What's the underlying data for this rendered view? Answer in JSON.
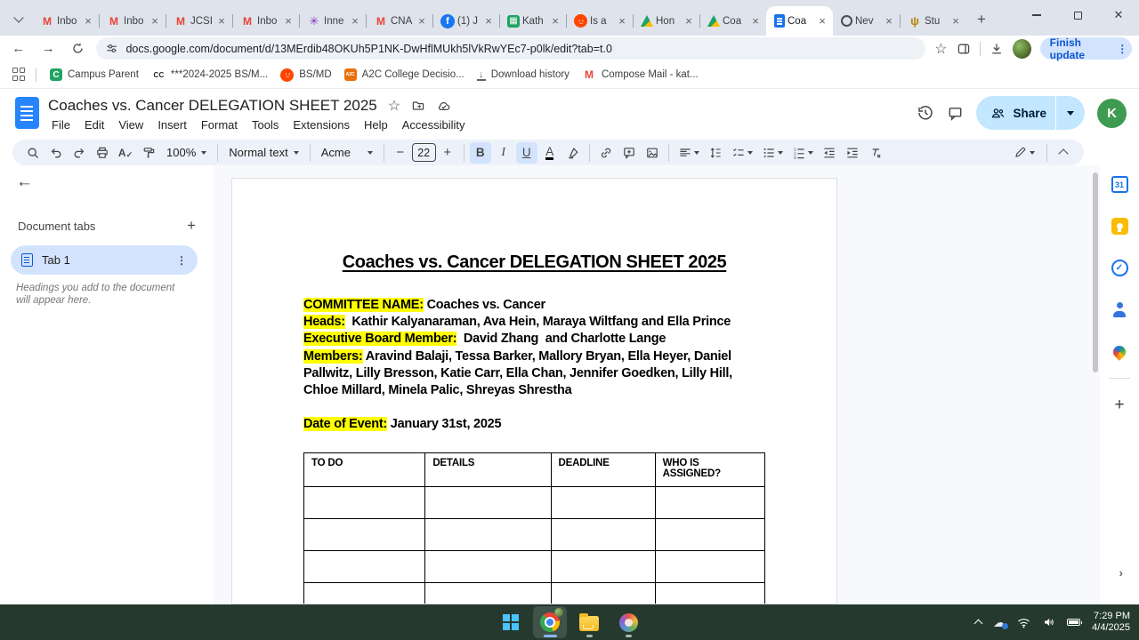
{
  "browser": {
    "tab_strip": {
      "tabs": [
        {
          "icon": "gmail",
          "label": "Inbo"
        },
        {
          "icon": "gmail",
          "label": "Inbo"
        },
        {
          "icon": "gmail",
          "label": "JCSI"
        },
        {
          "icon": "gmail",
          "label": "Inbo"
        },
        {
          "icon": "innerview",
          "label": "Inne"
        },
        {
          "icon": "gmail",
          "label": "CNA"
        },
        {
          "icon": "facebook",
          "label": "(1) J"
        },
        {
          "icon": "sheets",
          "label": "Kath"
        },
        {
          "icon": "reddit",
          "label": "Is a"
        },
        {
          "icon": "drive",
          "label": "Hon"
        },
        {
          "icon": "drive",
          "label": "Coa"
        },
        {
          "icon": "docs",
          "label": "Coa"
        },
        {
          "icon": "ring",
          "label": "Nev"
        },
        {
          "icon": "harp",
          "label": "Stu"
        }
      ],
      "active_index": 11
    },
    "address_bar": {
      "url": "docs.google.com/document/d/13MErdib48OKUh5P1NK-DwHflMUkh5lVkRwYEc7-p0lk/edit?tab=t.0",
      "update_button": "Finish update"
    },
    "bookmarks_bar": {
      "items": [
        {
          "icon": "campus",
          "label": "Campus Parent"
        },
        {
          "icon": "cc",
          "label": "***2024-2025 BS/M..."
        },
        {
          "icon": "reddit",
          "label": "BS/MD"
        },
        {
          "icon": "a2c",
          "label": "A2C College Decisio..."
        },
        {
          "icon": "download",
          "label": "Download history"
        },
        {
          "icon": "gmail",
          "label": "Compose Mail - kat..."
        }
      ]
    }
  },
  "docs": {
    "header": {
      "title": "Coaches vs. Cancer DELEGATION SHEET 2025",
      "menus": [
        "File",
        "Edit",
        "View",
        "Insert",
        "Format",
        "Tools",
        "Extensions",
        "Help",
        "Accessibility"
      ],
      "share_label": "Share",
      "avatar_letter": "K"
    },
    "toolbar": {
      "zoom": "100%",
      "paragraph_style": "Normal text",
      "font_family": "Acme",
      "font_size": "22"
    },
    "tabs_panel": {
      "heading": "Document tabs",
      "active_tab": "Tab 1",
      "hint": "Headings you add to the document will appear here."
    },
    "document": {
      "title": "Coaches vs. Cancer DELEGATION SHEET 2025",
      "fields": [
        {
          "label": "COMMITTEE NAME:",
          "value": " Coaches vs. Cancer",
          "gap_before": false
        },
        {
          "label": "Heads:",
          "value": "  Kathir Kalyanaraman, Ava Hein, Maraya Wiltfang and Ella Prince",
          "gap_before": false
        },
        {
          "label": "Executive Board Member:",
          "value": "  David Zhang  and Charlotte Lange",
          "gap_before": false
        },
        {
          "label": "Members:",
          "value": " Aravind Balaji, Tessa Barker, Mallory Bryan, Ella Heyer, Daniel Pallwitz, Lilly Bresson, Katie Carr, Ella Chan, Jennifer Goedken, Lilly Hill, Chloe Millard, Minela Palic, Shreyas Shrestha",
          "gap_before": false
        },
        {
          "label": "Date of Event:",
          "value": " January 31st, 2025",
          "gap_before": true
        }
      ],
      "table": {
        "headers": [
          "TO DO",
          "DETAILS",
          "DEADLINE",
          "WHO IS ASSIGNED?"
        ],
        "empty_rows": 4
      }
    }
  },
  "taskbar": {
    "time": "7:29 PM",
    "date": "4/4/2025"
  }
}
